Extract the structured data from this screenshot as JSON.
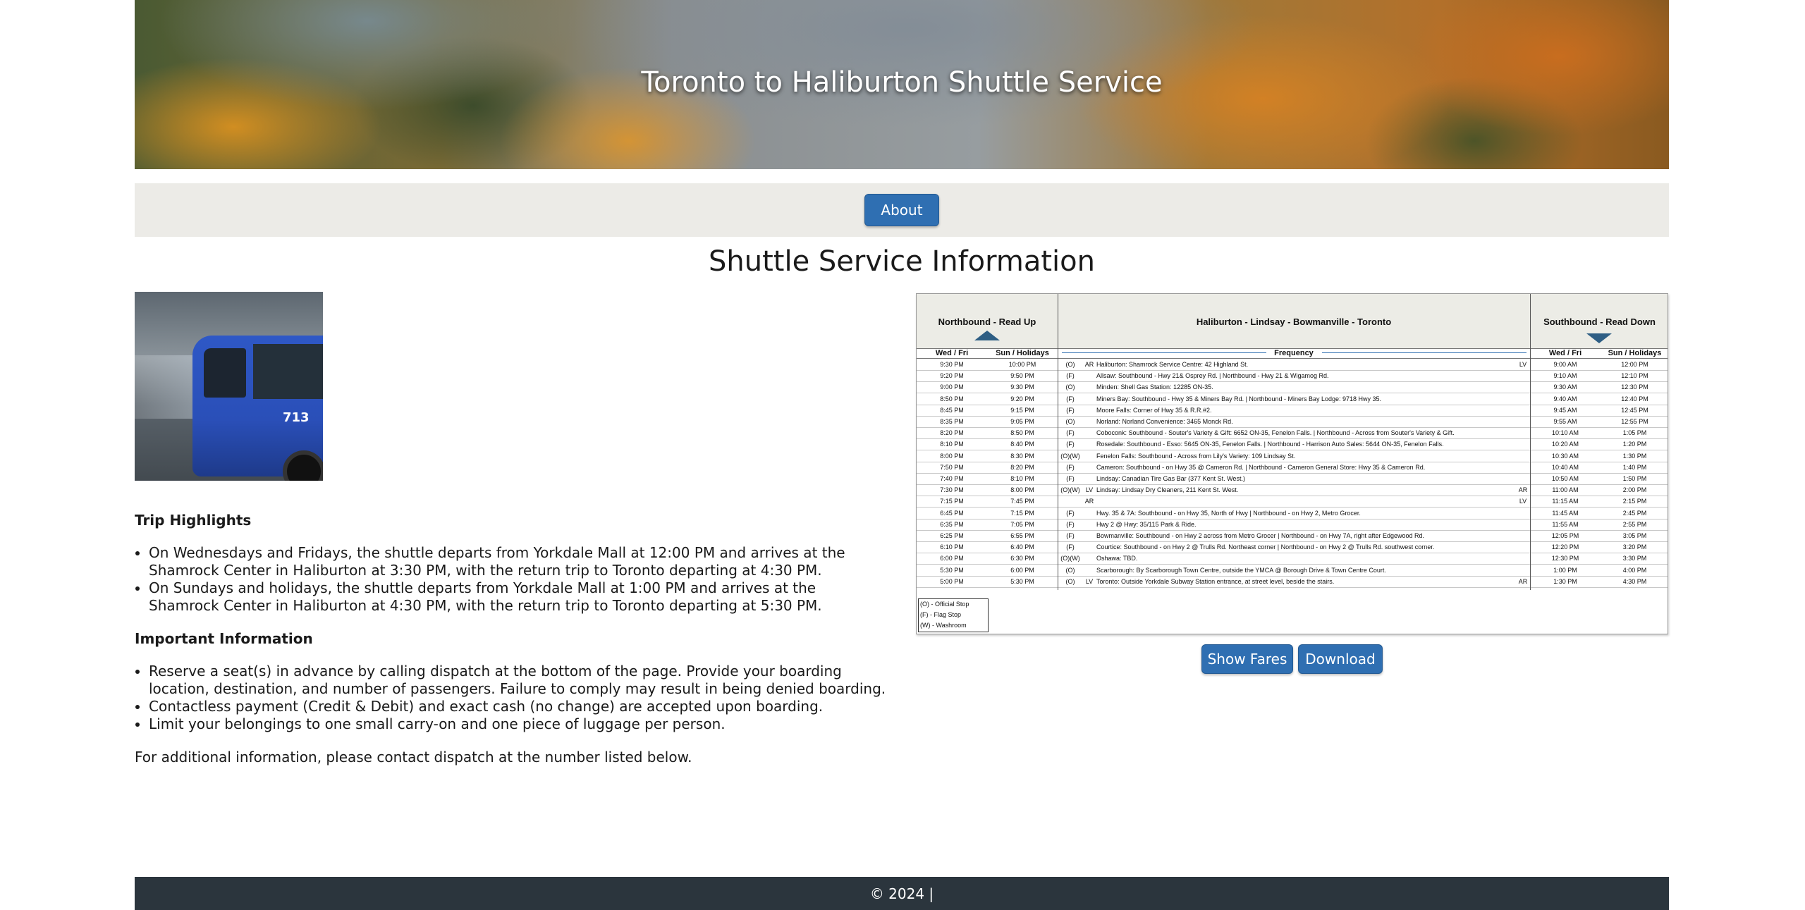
{
  "banner": {
    "title": "Toronto to Haliburton Shuttle Service"
  },
  "nav": {
    "about_label": "About"
  },
  "main": {
    "section_title": "Shuttle Service Information",
    "trip_highlights": {
      "heading": "Trip Highlights",
      "items": [
        "On Wednesdays and Fridays, the shuttle departs from Yorkdale Mall at 12:00 PM and arrives at the Shamrock Center in Haliburton at 3:30 PM, with the return trip to Toronto departing at 4:30 PM.",
        "On Sundays and holidays, the shuttle departs from Yorkdale Mall at 1:00 PM and arrives at the Shamrock Center in Haliburton at 4:30 PM, with the return trip to Toronto departing at 5:30 PM."
      ]
    },
    "important_info": {
      "heading": "Important Information",
      "items": [
        "Reserve a seat(s) in advance by calling dispatch at the bottom of the page. Provide your boarding location, destination, and number of passengers. Failure to comply may result in being denied boarding.",
        "Contactless payment (Credit & Debit) and exact cash (no change) are accepted upon boarding.",
        "Limit your belongings to one small carry-on and one piece of luggage per person."
      ]
    },
    "additional": "For additional information, please contact dispatch at the number listed below."
  },
  "schedule": {
    "northbound_title": "Northbound - Read Up",
    "route_title": "Haliburton - Lindsay - Bowmanville - Toronto",
    "southbound_title": "Southbound - Read Down",
    "col_wed_fri": "Wed / Fri",
    "col_sun_hol": "Sun / Holidays",
    "col_frequency": "Frequency",
    "rows": [
      {
        "nb1": "9:30 PM",
        "nb2": "10:00 PM",
        "freq": "(O)",
        "ar": "AR",
        "stop": "Haliburton: Shamrock Service Centre: 42 Highland St.",
        "lv": "LV",
        "sb1": "9:00 AM",
        "sb2": "12:00 PM"
      },
      {
        "nb1": "9:20 PM",
        "nb2": "9:50 PM",
        "freq": "(F)",
        "ar": "",
        "stop": "Allsaw: Southbound - Hwy 21& Osprey Rd. | Northbound - Hwy 21 & Wigamog Rd.",
        "lv": "",
        "sb1": "9:10 AM",
        "sb2": "12:10 PM"
      },
      {
        "nb1": "9:00 PM",
        "nb2": "9:30 PM",
        "freq": "(O)",
        "ar": "",
        "stop": "Minden: Shell Gas Station: 12285 ON-35.",
        "lv": "",
        "sb1": "9:30 AM",
        "sb2": "12:30 PM"
      },
      {
        "nb1": "8:50 PM",
        "nb2": "9:20 PM",
        "freq": "(F)",
        "ar": "",
        "stop": "Miners Bay: Southbound - Hwy 35 & Miners Bay Rd. | Northbound - Miners Bay Lodge: 9718 Hwy 35.",
        "lv": "",
        "sb1": "9:40 AM",
        "sb2": "12:40 PM"
      },
      {
        "nb1": "8:45 PM",
        "nb2": "9:15 PM",
        "freq": "(F)",
        "ar": "",
        "stop": "Moore Falls: Corner of Hwy 35 & R.R.#2.",
        "lv": "",
        "sb1": "9:45 AM",
        "sb2": "12:45 PM"
      },
      {
        "nb1": "8:35 PM",
        "nb2": "9:05 PM",
        "freq": "(O)",
        "ar": "",
        "stop": "Norland: Norland Convenience: 3465 Monck Rd.",
        "lv": "",
        "sb1": "9:55 AM",
        "sb2": "12:55 PM"
      },
      {
        "nb1": "8:20 PM",
        "nb2": "8:50 PM",
        "freq": "(F)",
        "ar": "",
        "stop": "Coboconk: Southbound - Souter's Variety & Gift: 6652 ON-35, Fenelon Falls. | Northbound - Across from Souter's Variety & Gift.",
        "lv": "",
        "sb1": "10:10 AM",
        "sb2": "1:05 PM"
      },
      {
        "nb1": "8:10 PM",
        "nb2": "8:40 PM",
        "freq": "(F)",
        "ar": "",
        "stop": "Rosedale: Southbound - Esso: 5645 ON-35, Fenelon Falls. | Northbound - Harrison Auto Sales: 5644 ON-35, Fenelon Falls.",
        "lv": "",
        "sb1": "10:20 AM",
        "sb2": "1:20 PM"
      },
      {
        "nb1": "8:00 PM",
        "nb2": "8:30 PM",
        "freq": "(O)(W)",
        "ar": "",
        "stop": "Fenelon Falls: Southbound - Across from Lily's Variety: 109 Lindsay St.",
        "lv": "",
        "sb1": "10:30 AM",
        "sb2": "1:30 PM"
      },
      {
        "nb1": "7:50 PM",
        "nb2": "8:20 PM",
        "freq": "(F)",
        "ar": "",
        "stop": "Cameron: Southbound - on Hwy 35 @ Cameron Rd. | Northbound - Cameron General Store: Hwy 35 & Cameron Rd.",
        "lv": "",
        "sb1": "10:40 AM",
        "sb2": "1:40 PM"
      },
      {
        "nb1": "7:40 PM",
        "nb2": "8:10 PM",
        "freq": "(F)",
        "ar": "",
        "stop": "Lindsay: Canadian Tire Gas Bar (377 Kent St. West.)",
        "lv": "",
        "sb1": "10:50 AM",
        "sb2": "1:50 PM"
      },
      {
        "nb1": "7:30 PM",
        "nb2": "8:00 PM",
        "freq": "(O)(W)",
        "ar": "LV",
        "stop": "Lindsay: Lindsay Dry Cleaners, 211 Kent St. West.",
        "lv": "AR",
        "sb1": "11:00 AM",
        "sb2": "2:00 PM"
      },
      {
        "nb1": "7:15 PM",
        "nb2": "7:45 PM",
        "freq": "",
        "ar": "AR",
        "stop": "",
        "lv": "LV",
        "sb1": "11:15 AM",
        "sb2": "2:15 PM"
      },
      {
        "nb1": "6:45 PM",
        "nb2": "7:15 PM",
        "freq": "(F)",
        "ar": "",
        "stop": "Hwy. 35 & 7A: Southbound - on Hwy 35, North of Hwy | Northbound - on Hwy 2, Metro Grocer.",
        "lv": "",
        "sb1": "11:45 AM",
        "sb2": "2:45 PM"
      },
      {
        "nb1": "6:35 PM",
        "nb2": "7:05 PM",
        "freq": "(F)",
        "ar": "",
        "stop": "Hwy 2 @ Hwy: 35/115 Park & Ride.",
        "lv": "",
        "sb1": "11:55 AM",
        "sb2": "2:55 PM"
      },
      {
        "nb1": "6:25 PM",
        "nb2": "6:55 PM",
        "freq": "(F)",
        "ar": "",
        "stop": "Bowmanville: Southbound - on Hwy 2 across from Metro Grocer | Northbound - on Hwy 7A, right after Edgewood Rd.",
        "lv": "",
        "sb1": "12:05 PM",
        "sb2": "3:05 PM"
      },
      {
        "nb1": "6:10 PM",
        "nb2": "6:40 PM",
        "freq": "(F)",
        "ar": "",
        "stop": "Courtice: Southbound - on Hwy 2 @ Trulls Rd. Northeast corner | Northbound - on Hwy 2 @ Trulls Rd. southwest corner.",
        "lv": "",
        "sb1": "12:20 PM",
        "sb2": "3:20 PM"
      },
      {
        "nb1": "6:00 PM",
        "nb2": "6:30 PM",
        "freq": "(O)(W)",
        "ar": "",
        "stop": "Oshawa: TBD.",
        "lv": "",
        "sb1": "12:30 PM",
        "sb2": "3:30 PM"
      },
      {
        "nb1": "5:30 PM",
        "nb2": "6:00 PM",
        "freq": "(O)",
        "ar": "",
        "stop": "Scarborough: By Scarborough Town Centre, outside the YMCA @ Borough Drive & Town Centre Court.",
        "lv": "",
        "sb1": "1:00 PM",
        "sb2": "4:00 PM"
      },
      {
        "nb1": "5:00 PM",
        "nb2": "5:30 PM",
        "freq": "(O)",
        "ar": "LV",
        "stop": "Toronto: Outside Yorkdale Subway Station entrance, at street level, beside the stairs.",
        "lv": "AR",
        "sb1": "1:30 PM",
        "sb2": "4:30 PM"
      }
    ],
    "legend": [
      "(O) - Official Stop",
      "(F) - Flag Stop",
      "(W) - Washroom"
    ],
    "show_fares_label": "Show Fares",
    "download_label": "Download"
  },
  "footer": {
    "text": "© 2024 |"
  },
  "colors": {
    "accent_button": "#2f6fb2",
    "nav_bg": "#ecebe7",
    "footer_bg": "#2b353d"
  },
  "icons": [
    "arrow-up-icon",
    "arrow-down-icon"
  ]
}
